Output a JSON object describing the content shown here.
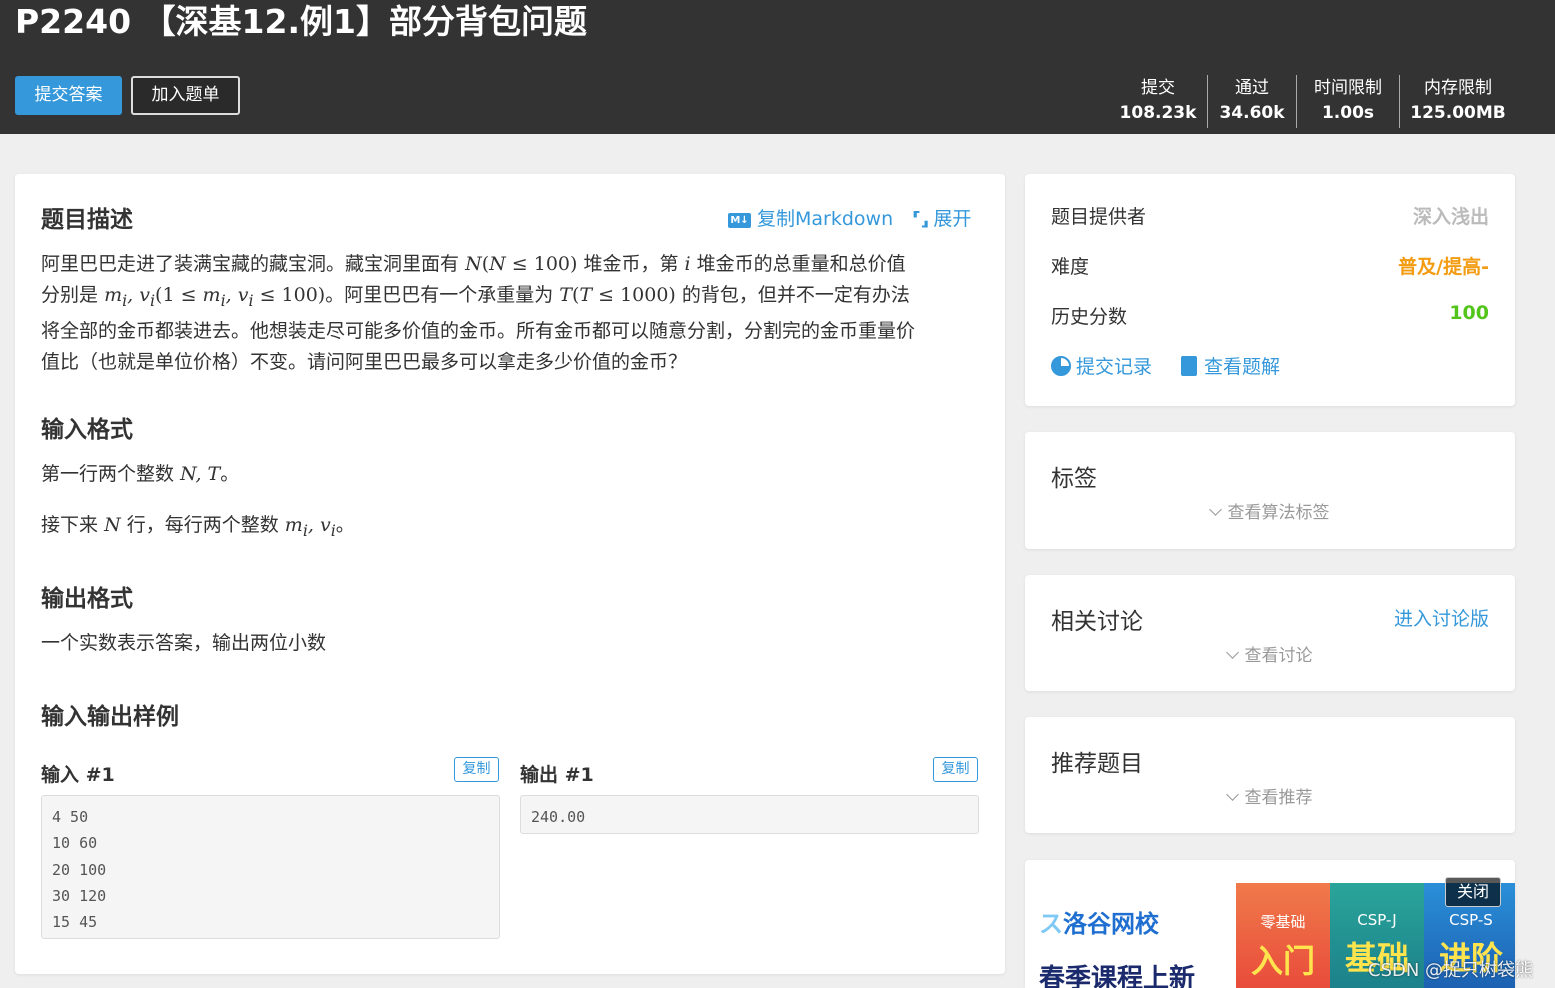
{
  "header": {
    "title": "P2240 【深基12.例1】部分背包问题",
    "submit_label": "提交答案",
    "add_label": "加入题单",
    "stats": [
      {
        "label": "提交",
        "value": "108.23k"
      },
      {
        "label": "通过",
        "value": "34.60k"
      },
      {
        "label": "时间限制",
        "value": "1.00s"
      },
      {
        "label": "内存限制",
        "value": "125.00MB"
      }
    ]
  },
  "problem": {
    "desc_title": "题目描述",
    "copy_markdown": "复制Markdown",
    "expand": "展开",
    "desc": {
      "p1": "阿里巴巴走进了装满宝藏的藏宝洞。藏宝洞里面有",
      "p2": "堆金币，第",
      "p3": "堆金币的总重量和总价值",
      "p4": "分别是",
      "p5": "。阿里巴巴有一个承重量为",
      "p6": "的背包，但并不一定有办法",
      "p7": "将全部的金币都装进去。他想装走尽可能多价值的金币。所有金币都可以随意分割，分割完的金币重量价",
      "p8": "值比（也就是单位价格）不变。请问阿里巴巴最多可以拿走多少价值的金币？"
    },
    "input_title": "输入格式",
    "input_l1_a": "第一行两个整数",
    "input_l1_b": "。",
    "input_l2_a": "接下来",
    "input_l2_b": "行，每行两个整数",
    "input_l2_c": "。",
    "output_title": "输出格式",
    "output_text": "一个实数表示答案，输出两位小数",
    "samples_title": "输入输出样例",
    "sample_in_label": "输入 #1",
    "sample_out_label": "输出 #1",
    "copy_label": "复制",
    "sample_in": "4 50\n10 60\n20 100\n30 120\n15 45",
    "sample_out": "240.00"
  },
  "info": {
    "provider_label": "题目提供者",
    "provider_value": "深入浅出",
    "difficulty_label": "难度",
    "difficulty_value": "普及/提高-",
    "score_label": "历史分数",
    "score_value": "100",
    "records_link": "提交记录",
    "solutions_link": "查看题解"
  },
  "tags": {
    "title": "标签",
    "sub": "查看算法标签"
  },
  "discuss": {
    "title": "相关讨论",
    "link": "进入讨论版",
    "sub": "查看讨论"
  },
  "recommend": {
    "title": "推荐题目",
    "sub": "查看推荐"
  },
  "ad": {
    "logo": "洛谷网校",
    "slogan": "春季课程上新",
    "close": "关闭",
    "panels": [
      {
        "top": "零基础",
        "big": "入门"
      },
      {
        "top": "CSP-J",
        "big": "基础"
      },
      {
        "top": "CSP-S",
        "big": "进阶"
      }
    ]
  },
  "watermark": "CSDN @捉只树袋熊",
  "colors": {
    "header_bg": "#333333",
    "accent": "#3498db",
    "difficulty": "#f39c11",
    "score": "#52c41a"
  }
}
